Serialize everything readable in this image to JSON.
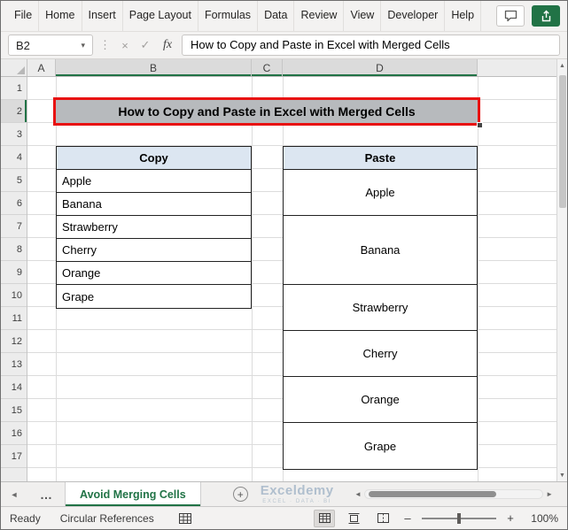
{
  "ribbon": {
    "tabs": [
      "File",
      "Home",
      "Insert",
      "Page Layout",
      "Formulas",
      "Data",
      "Review",
      "View",
      "Developer",
      "Help"
    ]
  },
  "formula_bar": {
    "name_box_value": "B2",
    "fx_label": "fx",
    "formula_text": "How to Copy and Paste in Excel with Merged Cells"
  },
  "grid": {
    "column_headers": [
      "A",
      "B",
      "C",
      "D"
    ],
    "row_numbers": [
      "1",
      "2",
      "3",
      "4",
      "5",
      "6",
      "7",
      "8",
      "9",
      "10",
      "11",
      "12",
      "13",
      "14",
      "15",
      "16",
      "17"
    ],
    "title_cell_text": "How to Copy and Paste in Excel with Merged Cells",
    "copy_table": {
      "header": "Copy",
      "items": [
        "Apple",
        "Banana",
        "Strawberry",
        "Cherry",
        "Orange",
        "Grape"
      ]
    },
    "paste_table": {
      "header": "Paste",
      "items": [
        "Apple",
        "Banana",
        "Strawberry",
        "Cherry",
        "Orange",
        "Grape"
      ]
    }
  },
  "sheet_bar": {
    "more_tabs_ellipsis": "…",
    "active_tab_label": "Avoid Merging Cells",
    "watermark_title": "Exceldemy",
    "watermark_subtitle": "EXCEL · DATA · BI"
  },
  "status_bar": {
    "mode": "Ready",
    "message": "Circular References",
    "zoom_level": "100%"
  },
  "icons": {
    "chevron_down": "▾",
    "cancel": "×",
    "enter": "✓",
    "vertical_dots": "⋮",
    "up": "▲",
    "down": "▼",
    "left": "◄",
    "right": "►",
    "nav_left": "◄",
    "add": "+",
    "minus": "–",
    "plus": "+"
  },
  "colors": {
    "accent_green": "#217346",
    "selection_red": "#e81111",
    "table_header_fill": "#dce6f1",
    "title_fill": "#b7babd"
  }
}
